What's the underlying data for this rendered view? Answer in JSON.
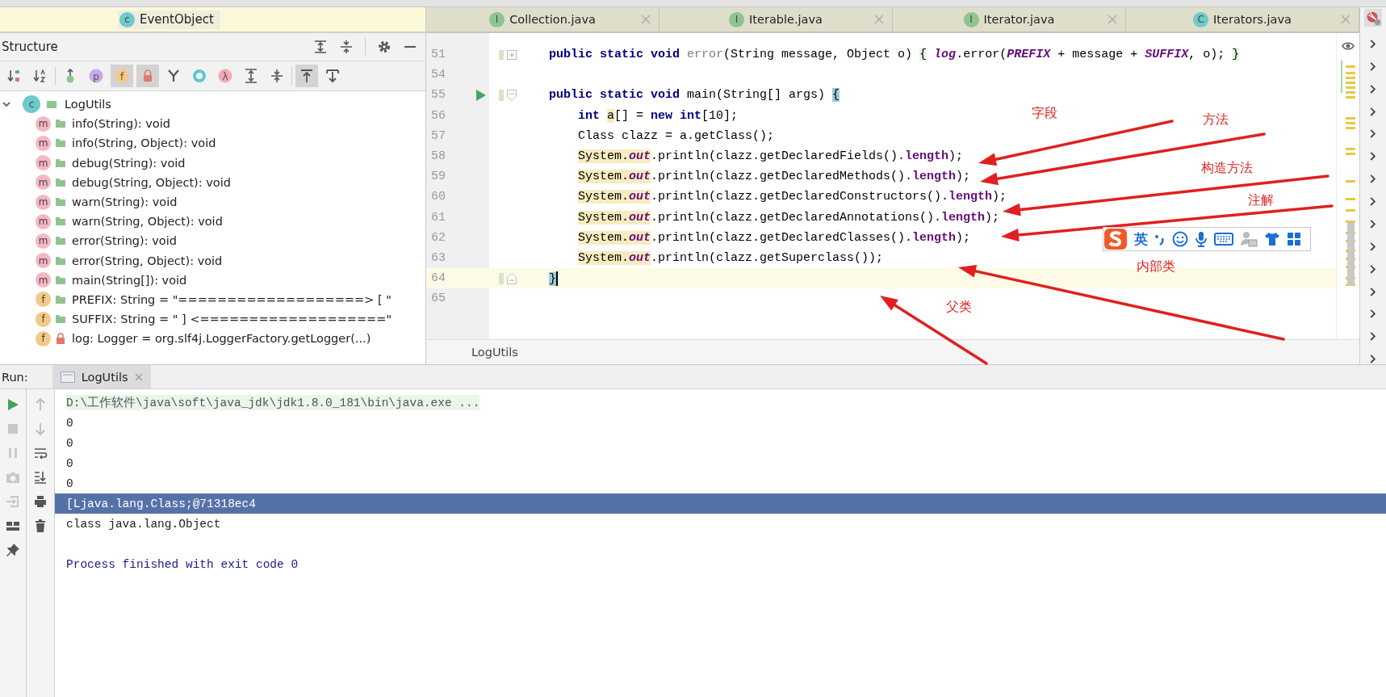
{
  "project_panel": {
    "item": {
      "badge": "c",
      "label": "EventObject"
    }
  },
  "structure": {
    "title": "Structure",
    "toolbar": [
      {
        "kind": "sort-visibility",
        "selected": false
      },
      {
        "kind": "sort-alpha",
        "selected": false
      },
      {
        "kind": "inherited",
        "selected": false
      },
      {
        "kind": "letter",
        "glyph": "p",
        "color": "#c9a9e6",
        "selected": false
      },
      {
        "kind": "letter",
        "glyph": "f",
        "color": "#f3c985",
        "selected": true
      },
      {
        "kind": "lock",
        "selected": true
      },
      {
        "kind": "anonymous",
        "selected": false
      },
      {
        "kind": "ring",
        "selected": false
      },
      {
        "kind": "letter",
        "glyph": "λ",
        "color": "#f5a9b8",
        "selected": false
      },
      {
        "kind": "expand",
        "selected": false
      },
      {
        "kind": "collapse",
        "selected": false
      },
      {
        "kind": "scroll-to",
        "selected": true
      },
      {
        "kind": "scroll-from",
        "selected": false
      }
    ],
    "tree": [
      {
        "badge": "c",
        "kind": "class",
        "private": false,
        "label": "LogUtils",
        "expanded": true,
        "children": [
          {
            "badge": "m",
            "kind": "method",
            "private": false,
            "label": "info(String): void"
          },
          {
            "badge": "m",
            "kind": "method",
            "private": false,
            "label": "info(String, Object): void"
          },
          {
            "badge": "m",
            "kind": "method",
            "private": false,
            "label": "debug(String): void"
          },
          {
            "badge": "m",
            "kind": "method",
            "private": false,
            "label": "debug(String, Object): void"
          },
          {
            "badge": "m",
            "kind": "method",
            "private": false,
            "label": "warn(String): void"
          },
          {
            "badge": "m",
            "kind": "method",
            "private": false,
            "label": "warn(String, Object): void"
          },
          {
            "badge": "m",
            "kind": "method",
            "private": false,
            "label": "error(String): void"
          },
          {
            "badge": "m",
            "kind": "method",
            "private": false,
            "label": "error(String, Object): void"
          },
          {
            "badge": "m",
            "kind": "method",
            "private": false,
            "label": "main(String[]): void"
          },
          {
            "badge": "f",
            "kind": "field",
            "private": false,
            "label": "PREFIX: String = \"===================> [ \""
          },
          {
            "badge": "f",
            "kind": "field",
            "private": false,
            "label": "SUFFIX: String = \" ] <===================\""
          },
          {
            "badge": "f",
            "kind": "field",
            "private": true,
            "label": "log: Logger = org.slf4j.LoggerFactory.getLogger(...)"
          }
        ]
      }
    ]
  },
  "editor": {
    "tabs": [
      {
        "badge": "I",
        "kind": "interface",
        "label": "Collection.java",
        "selected": false
      },
      {
        "badge": "I",
        "kind": "interface",
        "label": "Iterable.java",
        "selected": false
      },
      {
        "badge": "I",
        "kind": "interface",
        "label": "Iterator.java",
        "selected": false
      },
      {
        "badge": "C",
        "kind": "class",
        "label": "Iterators.java",
        "selected": false
      }
    ],
    "lines": [
      {
        "number": "51",
        "kind": "collapsed",
        "runnable": false,
        "current": false,
        "tokens": [
          {
            "kind": "kw",
            "text": "public static void "
          },
          {
            "kind": "unused",
            "text": "error"
          },
          {
            "kind": "plain",
            "text": "(String message, Object o) "
          },
          {
            "kind": "fold",
            "text": "{"
          },
          {
            "kind": "field",
            "text": " log"
          },
          {
            "kind": "plain",
            "text": ".error("
          },
          {
            "kind": "const",
            "text": "PREFIX"
          },
          {
            "kind": "plain",
            "text": " + message + "
          },
          {
            "kind": "const",
            "text": "SUFFIX"
          },
          {
            "kind": "plain",
            "text": ", o); "
          },
          {
            "kind": "fold",
            "text": "}"
          }
        ]
      },
      {
        "number": "54",
        "kind": "code",
        "runnable": false,
        "current": false
      },
      {
        "number": "55",
        "kind": "block-start",
        "runnable": true,
        "current": false,
        "tokens": [
          {
            "kind": "kw",
            "text": "public static void "
          },
          {
            "kind": "plain",
            "text": "main(String[] args) "
          },
          {
            "kind": "brace",
            "text": "{"
          }
        ]
      },
      {
        "number": "56",
        "kind": "code",
        "runnable": false,
        "current": false,
        "tokens": [
          {
            "kind": "kw",
            "text": "int "
          },
          {
            "kind": "usage",
            "text": "a"
          },
          {
            "kind": "plain",
            "text": "[] = "
          },
          {
            "kind": "kw",
            "text": "new int"
          },
          {
            "kind": "plain",
            "text": "[10];"
          }
        ]
      },
      {
        "number": "57",
        "kind": "code",
        "runnable": false,
        "current": false,
        "tokens": [
          {
            "kind": "plain",
            "text": "Class clazz = a.getClass();"
          }
        ]
      },
      {
        "number": "58",
        "kind": "code",
        "runnable": false,
        "current": false,
        "tokens": [
          {
            "kind": "usage",
            "text": "System."
          },
          {
            "kind": "usage-field",
            "text": "out"
          },
          {
            "kind": "plain",
            "text": ".println(clazz.getDeclaredFields()."
          },
          {
            "kind": "prop",
            "text": "length"
          },
          {
            "kind": "plain",
            "text": ");"
          }
        ]
      },
      {
        "number": "59",
        "kind": "code",
        "runnable": false,
        "current": false,
        "tokens": [
          {
            "kind": "usage",
            "text": "System."
          },
          {
            "kind": "usage-field",
            "text": "out"
          },
          {
            "kind": "plain",
            "text": ".println(clazz.getDeclaredMethods()."
          },
          {
            "kind": "prop",
            "text": "length"
          },
          {
            "kind": "plain",
            "text": ");"
          }
        ]
      },
      {
        "number": "60",
        "kind": "code",
        "runnable": false,
        "current": false,
        "tokens": [
          {
            "kind": "usage",
            "text": "System."
          },
          {
            "kind": "usage-field",
            "text": "out"
          },
          {
            "kind": "plain",
            "text": ".println(clazz.getDeclaredConstructors()."
          },
          {
            "kind": "prop",
            "text": "length"
          },
          {
            "kind": "plain",
            "text": ");"
          }
        ]
      },
      {
        "number": "61",
        "kind": "code",
        "runnable": false,
        "current": false,
        "tokens": [
          {
            "kind": "usage",
            "text": "System."
          },
          {
            "kind": "usage-field",
            "text": "out"
          },
          {
            "kind": "plain",
            "text": ".println(clazz.getDeclaredAnnotations()."
          },
          {
            "kind": "prop",
            "text": "length"
          },
          {
            "kind": "plain",
            "text": ");"
          }
        ]
      },
      {
        "number": "62",
        "kind": "code",
        "runnable": false,
        "current": false,
        "tokens": [
          {
            "kind": "usage",
            "text": "System."
          },
          {
            "kind": "usage-field",
            "text": "out"
          },
          {
            "kind": "plain",
            "text": ".println(clazz.getDeclaredClasses()."
          },
          {
            "kind": "prop",
            "text": "length"
          },
          {
            "kind": "plain",
            "text": ");"
          }
        ]
      },
      {
        "number": "63",
        "kind": "code",
        "runnable": false,
        "current": false,
        "tokens": [
          {
            "kind": "usage",
            "text": "System."
          },
          {
            "kind": "usage-field",
            "text": "out"
          },
          {
            "kind": "plain",
            "text": ".println(clazz.getSuperclass());"
          }
        ]
      },
      {
        "number": "64",
        "kind": "block-end",
        "runnable": false,
        "current": true,
        "tokens": [
          {
            "kind": "brace",
            "text": "}"
          }
        ]
      },
      {
        "number": "65",
        "kind": "code",
        "runnable": false,
        "current": false
      }
    ],
    "breadcrumb": "LogUtils"
  },
  "annotations": {
    "labels": [
      "字段",
      "方法",
      "构造方法",
      "注解",
      "内部类",
      "父类"
    ]
  },
  "input_method": {
    "language": "英"
  },
  "run": {
    "title": "Run:",
    "tab": {
      "label": "LogUtils",
      "selected": true
    },
    "toolbar_main": [
      {
        "kind": "run",
        "disabled": false
      },
      {
        "kind": "stop",
        "disabled": true
      },
      {
        "kind": "pause",
        "disabled": true
      },
      {
        "kind": "camera",
        "disabled": true
      },
      {
        "kind": "enter",
        "disabled": true
      },
      {
        "kind": "layout",
        "disabled": false
      },
      {
        "kind": "pin",
        "disabled": false
      }
    ],
    "toolbar_side": [
      {
        "kind": "up",
        "disabled": true
      },
      {
        "kind": "down",
        "disabled": true
      },
      {
        "kind": "wrap",
        "disabled": false
      },
      {
        "kind": "scroll-end",
        "disabled": false
      },
      {
        "kind": "print",
        "disabled": false
      },
      {
        "kind": "trash",
        "disabled": false
      }
    ],
    "output": [
      {
        "kind": "command",
        "text": "D:\\工作软件\\java\\soft\\java_jdk\\jdk1.8.0_181\\bin\\java.exe ...",
        "selected": false
      },
      {
        "kind": "stdout",
        "text": "0",
        "selected": false
      },
      {
        "kind": "stdout",
        "text": "0",
        "selected": false
      },
      {
        "kind": "stdout",
        "text": "0",
        "selected": false
      },
      {
        "kind": "stdout",
        "text": "0",
        "selected": false
      },
      {
        "kind": "stdout",
        "text": "[Ljava.lang.Class;@71318ec4",
        "selected": true
      },
      {
        "kind": "stdout",
        "text": "class java.lang.Object",
        "selected": false
      },
      {
        "kind": "blank",
        "selected": false
      },
      {
        "kind": "exit",
        "text": "Process finished with exit code 0",
        "selected": false
      }
    ]
  }
}
